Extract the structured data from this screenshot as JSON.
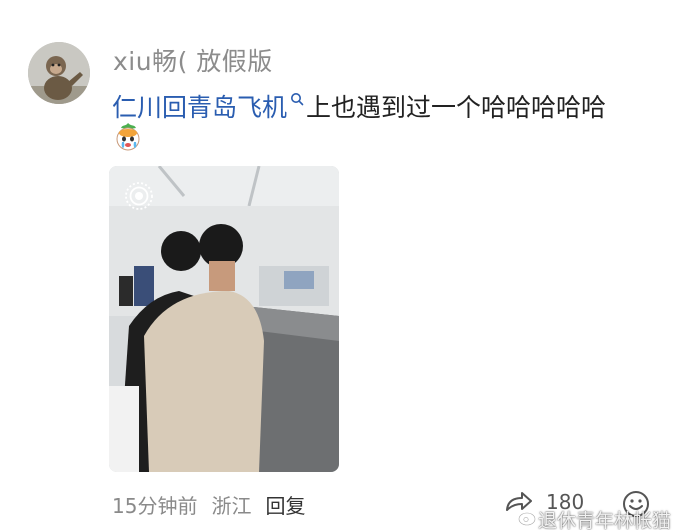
{
  "comment": {
    "username": "xiu畅( 放假版",
    "text_link": "仁川回青岛飞机",
    "text_rest": "上也遇到过一个哈哈哈哈哈",
    "time": "15分钟前",
    "location": "浙江",
    "reply_label": "回复",
    "like_count": "180"
  },
  "watermark": {
    "text": "退休青年林帐猫"
  },
  "icons": {
    "avatar": "monkey-avatar",
    "search": "search-icon",
    "emoji": "crying-emoji",
    "live": "live-photo-icon",
    "share": "share-icon",
    "smile": "smile-icon",
    "weibo": "weibo-icon"
  },
  "colors": {
    "link": "#2a5db0",
    "meta": "#8a8a8a",
    "text": "#222222"
  }
}
